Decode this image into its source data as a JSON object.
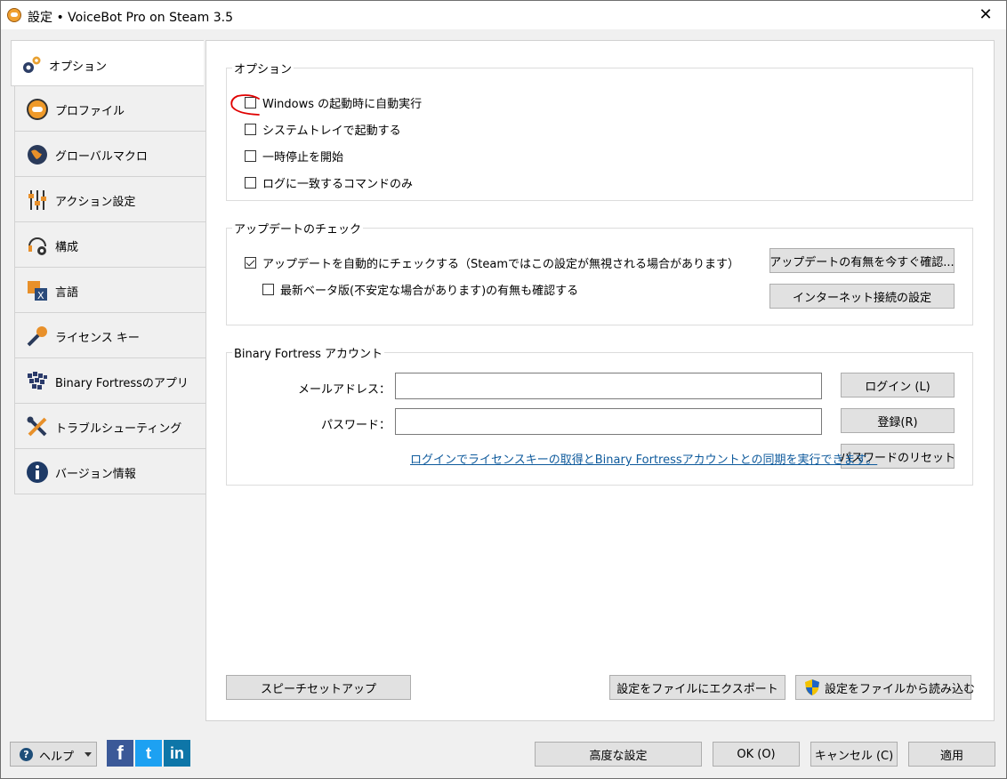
{
  "window": {
    "title": "設定 • VoiceBot Pro on Steam 3.5",
    "close_glyph": "✕"
  },
  "sidebar": {
    "items": [
      {
        "label": "オプション",
        "icon": "gears-icon",
        "active": true
      },
      {
        "label": "プロファイル",
        "icon": "profile-icon"
      },
      {
        "label": "グローバルマクロ",
        "icon": "globe-icon"
      },
      {
        "label": "アクション設定",
        "icon": "sliders-icon"
      },
      {
        "label": "構成",
        "icon": "headset-gear-icon"
      },
      {
        "label": "言語",
        "icon": "language-icon"
      },
      {
        "label": "ライセンス キー",
        "icon": "key-icon"
      },
      {
        "label": "Binary Fortressのアプリ",
        "icon": "binary-fortress-icon"
      },
      {
        "label": "トラブルシューティング",
        "icon": "tools-icon"
      },
      {
        "label": "バージョン情報",
        "icon": "info-icon"
      }
    ]
  },
  "options": {
    "title": "オプション",
    "checkboxes": [
      {
        "label": "Windows の起動時に自動実行",
        "checked": false
      },
      {
        "label": "システムトレイで起動する",
        "checked": false
      },
      {
        "label": "一時停止を開始",
        "checked": false
      },
      {
        "label": "ログに一致するコマンドのみ",
        "checked": false
      }
    ]
  },
  "updates": {
    "title": "アップデートのチェック",
    "auto_check_label": "アップデートを自動的にチェックする（Steamではこの設定が無視される場合があります）",
    "beta_label": "最新ベータ版(不安定な場合があります)の有無も確認する",
    "check_now_button": "アップデートの有無を今すぐ確認...",
    "internet_button": "インターネット接続の設定"
  },
  "account": {
    "title": "Binary Fortress アカウント",
    "email_label": "メールアドレス：",
    "password_label": "パスワード：",
    "email_value": "",
    "password_value": "",
    "login_button": "ログイン (L)",
    "register_button": "登録(R)",
    "reset_button": "パスワードのリセット",
    "info_link": "ログインでライセンスキーの取得とBinary Fortressアカウントとの同期を実行できます。"
  },
  "main_actions": {
    "speech_setup": "スピーチセットアップ",
    "export": "設定をファイルにエクスポート",
    "import": "設定をファイルから読み込む"
  },
  "footer": {
    "help_label": "ヘルプ",
    "help_icon_glyph": "?",
    "social": {
      "facebook": "f",
      "twitter": "t",
      "linkedin": "in"
    },
    "advanced_button": "高度な設定",
    "ok_button": "OK (O)",
    "cancel_button": "キャンセル (C)",
    "apply_button": "適用"
  },
  "colors": {
    "link": "#0e5a9c",
    "annotation": "#e00000"
  }
}
